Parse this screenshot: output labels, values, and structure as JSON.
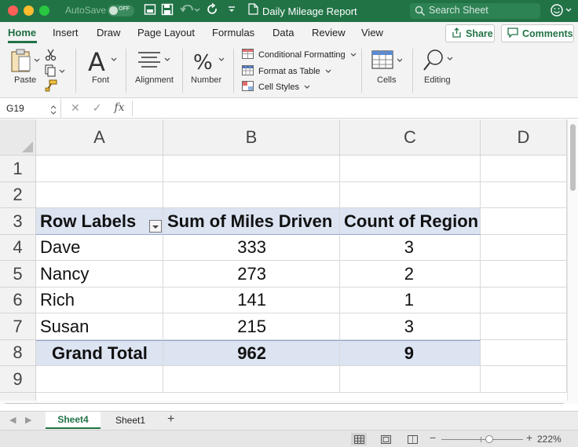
{
  "titlebar": {
    "autosave_label": "AutoSave",
    "autosave_state": "OFF",
    "doc_title": "Daily Mileage Report",
    "search_placeholder": "Search Sheet"
  },
  "tabs": [
    "Home",
    "Insert",
    "Draw",
    "Page Layout",
    "Formulas",
    "Data",
    "Review",
    "View"
  ],
  "active_tab": "Home",
  "share_label": "Share",
  "comments_label": "Comments",
  "ribbon": {
    "paste": "Paste",
    "font": "Font",
    "alignment": "Alignment",
    "number": "Number",
    "conditional_formatting": "Conditional Formatting",
    "format_as_table": "Format as Table",
    "cell_styles": "Cell Styles",
    "cells": "Cells",
    "editing": "Editing"
  },
  "formula_bar": {
    "name_box": "G19",
    "fx": "fx",
    "content": ""
  },
  "grid": {
    "columns": [
      "A",
      "B",
      "C",
      "D"
    ],
    "rows": [
      "1",
      "2",
      "3",
      "4",
      "5",
      "6",
      "7",
      "8",
      "9"
    ],
    "pivot": {
      "headers": [
        "Row Labels",
        "Sum of Miles Driven",
        "Count of Region"
      ],
      "rows": [
        {
          "label": "Dave",
          "miles": "333",
          "count": "3"
        },
        {
          "label": "Nancy",
          "miles": "273",
          "count": "2"
        },
        {
          "label": "Rich",
          "miles": "141",
          "count": "1"
        },
        {
          "label": "Susan",
          "miles": "215",
          "count": "3"
        }
      ],
      "total": {
        "label": "Grand Total",
        "miles": "962",
        "count": "9"
      }
    }
  },
  "sheets": [
    "Sheet4",
    "Sheet1"
  ],
  "active_sheet": "Sheet4",
  "status": {
    "zoom": "222%"
  },
  "colors": {
    "brand": "#217346",
    "pivot_fill": "#dce3f1"
  }
}
